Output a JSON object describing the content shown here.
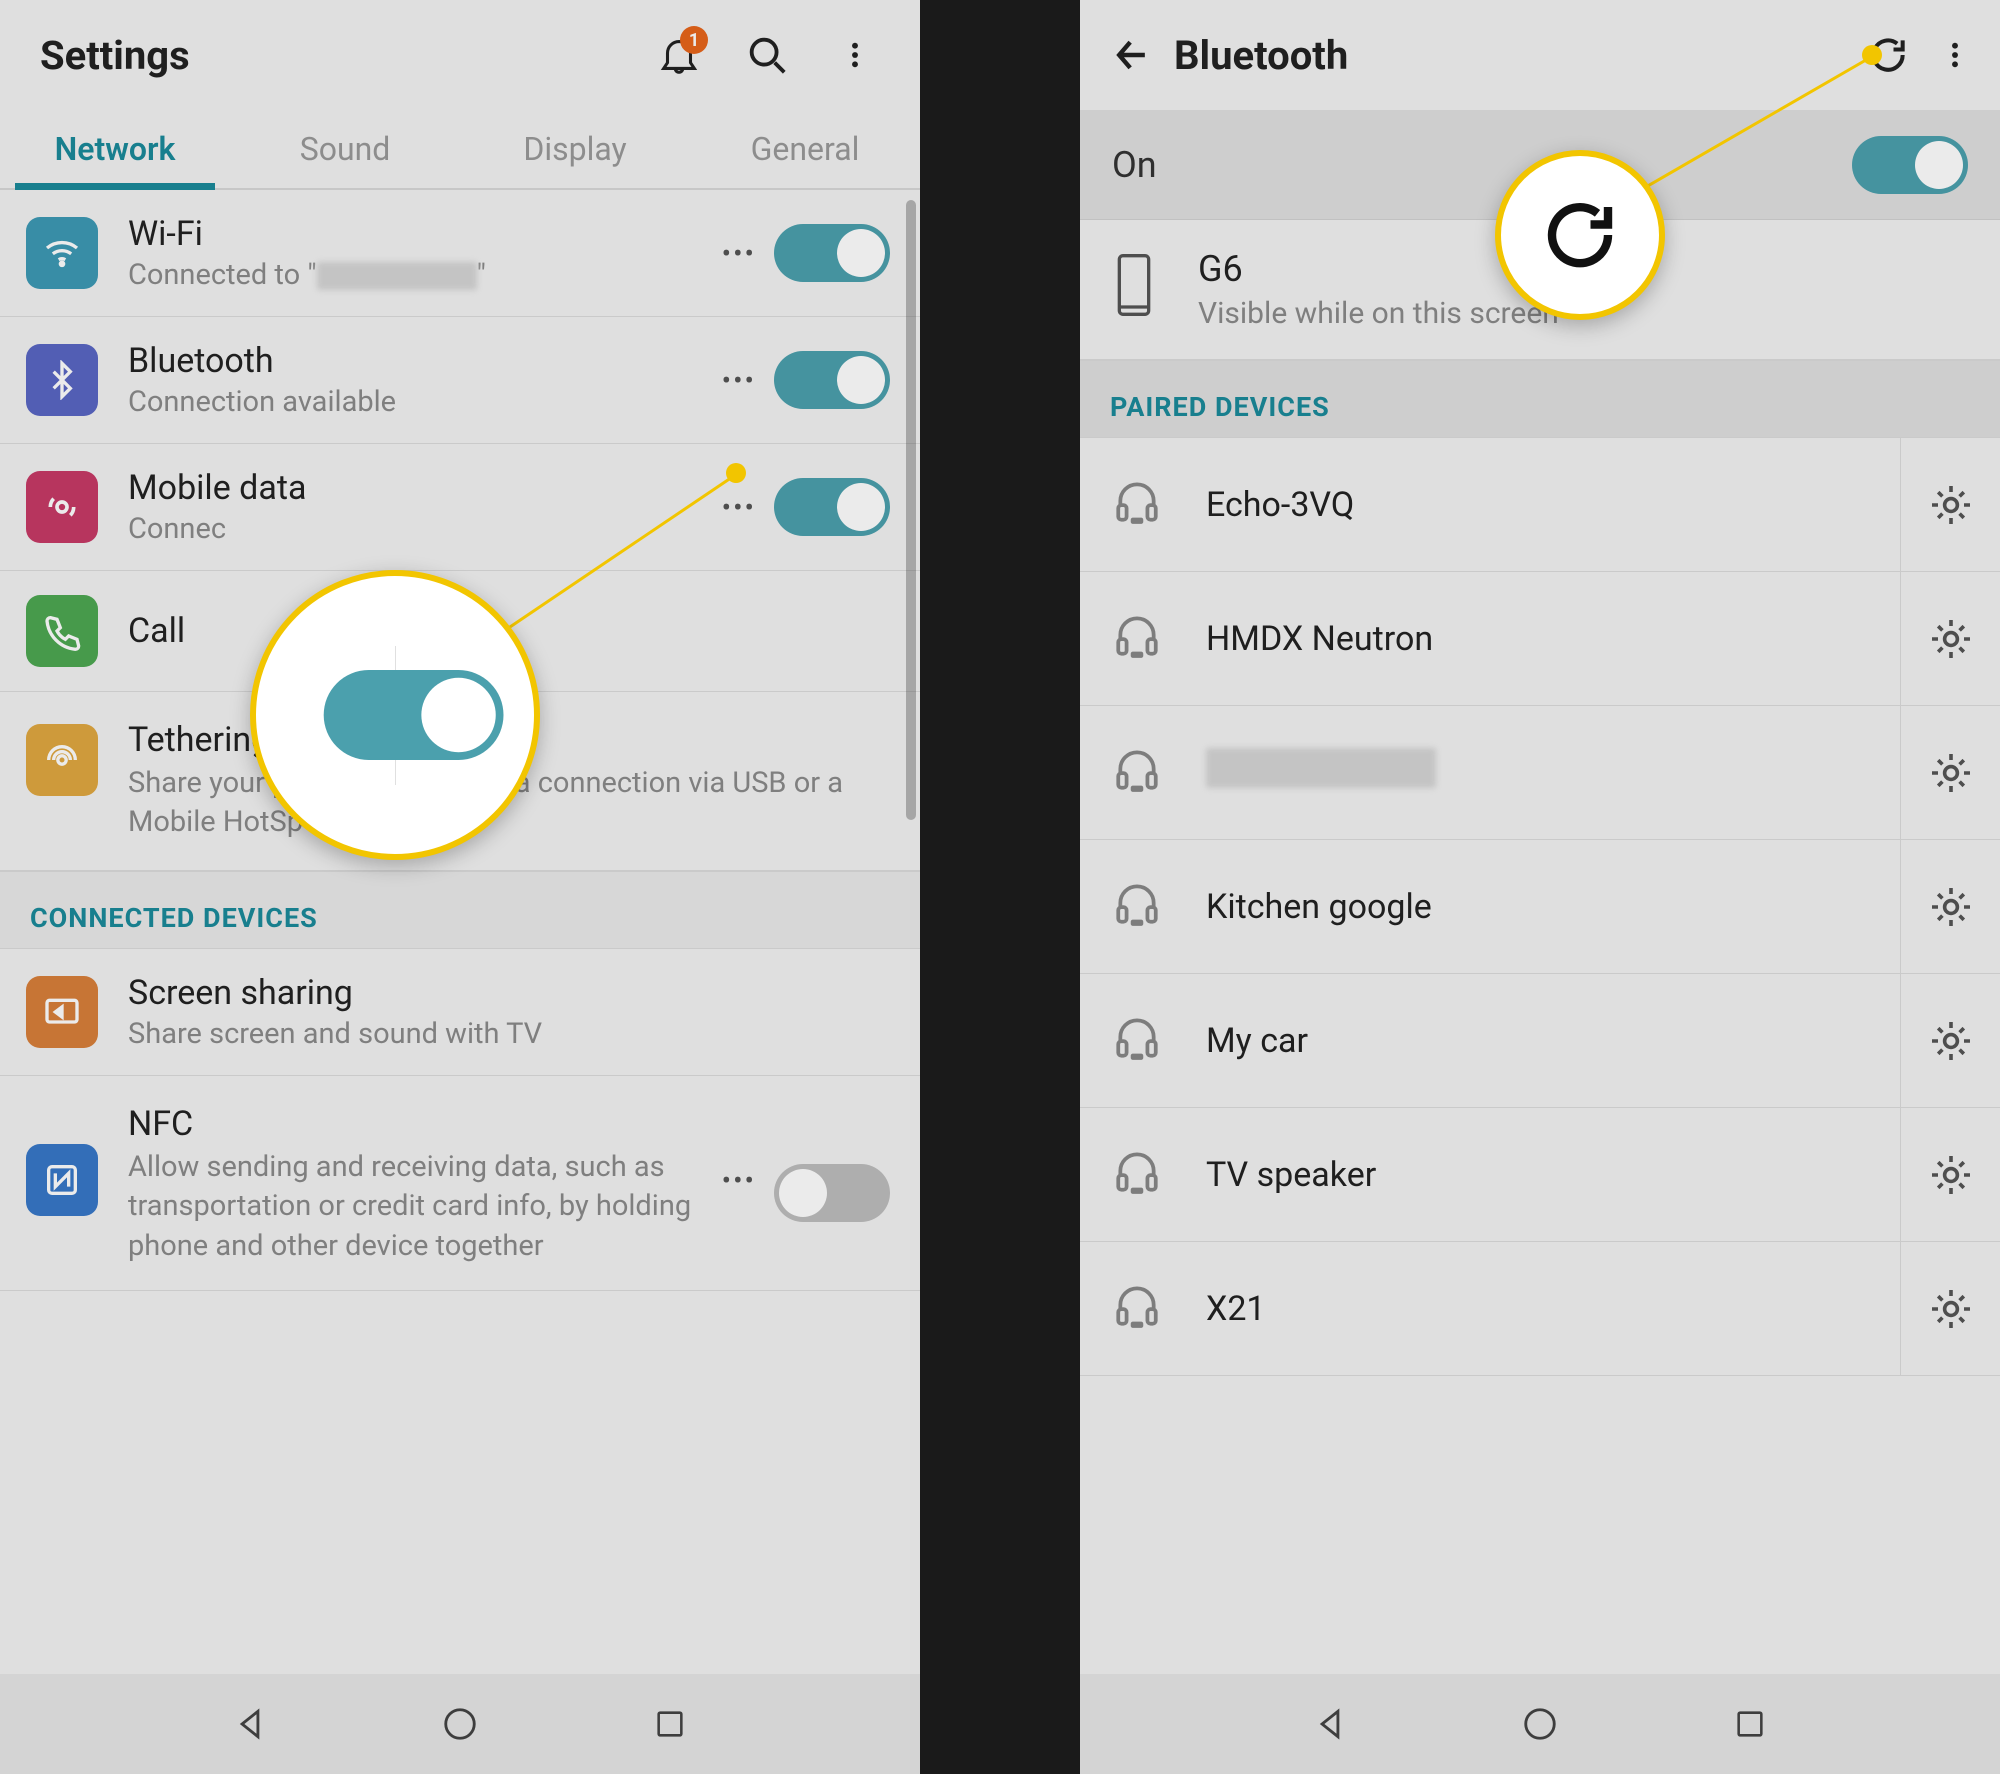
{
  "left": {
    "title": "Settings",
    "notif_badge": "1",
    "tabs": [
      "Network",
      "Sound",
      "Display",
      "General"
    ],
    "active_tab": 0,
    "rows": {
      "wifi": {
        "title": "Wi-Fi",
        "sub_pre": "Connected to \"",
        "sub_post": "\""
      },
      "bluetooth": {
        "title": "Bluetooth",
        "sub": "Connection available"
      },
      "mobile": {
        "title": "Mobile data",
        "sub_pre": "Connec"
      },
      "call": {
        "title": "Call"
      },
      "tether": {
        "title": "Tethering",
        "sub": "Share your phone's mobile data connection via USB or a Mobile HotSpot"
      }
    },
    "section_connected": "CONNECTED DEVICES",
    "rows2": {
      "screen": {
        "title": "Screen sharing",
        "sub": "Share screen and sound with TV"
      },
      "nfc": {
        "title": "NFC",
        "sub": "Allow sending and receiving data, such as transportation or credit card info, by holding phone and other device together"
      }
    }
  },
  "right": {
    "title": "Bluetooth",
    "on_label": "On",
    "self": {
      "name": "G6",
      "sub": "Visible while on this screen"
    },
    "section_paired": "PAIRED DEVICES",
    "devices": [
      {
        "name": "Echo-3VQ"
      },
      {
        "name": "HMDX Neutron"
      },
      {
        "name": "",
        "redacted": true
      },
      {
        "name": "Kitchen google"
      },
      {
        "name": "My car"
      },
      {
        "name": "TV speaker"
      },
      {
        "name": "X21"
      }
    ]
  }
}
